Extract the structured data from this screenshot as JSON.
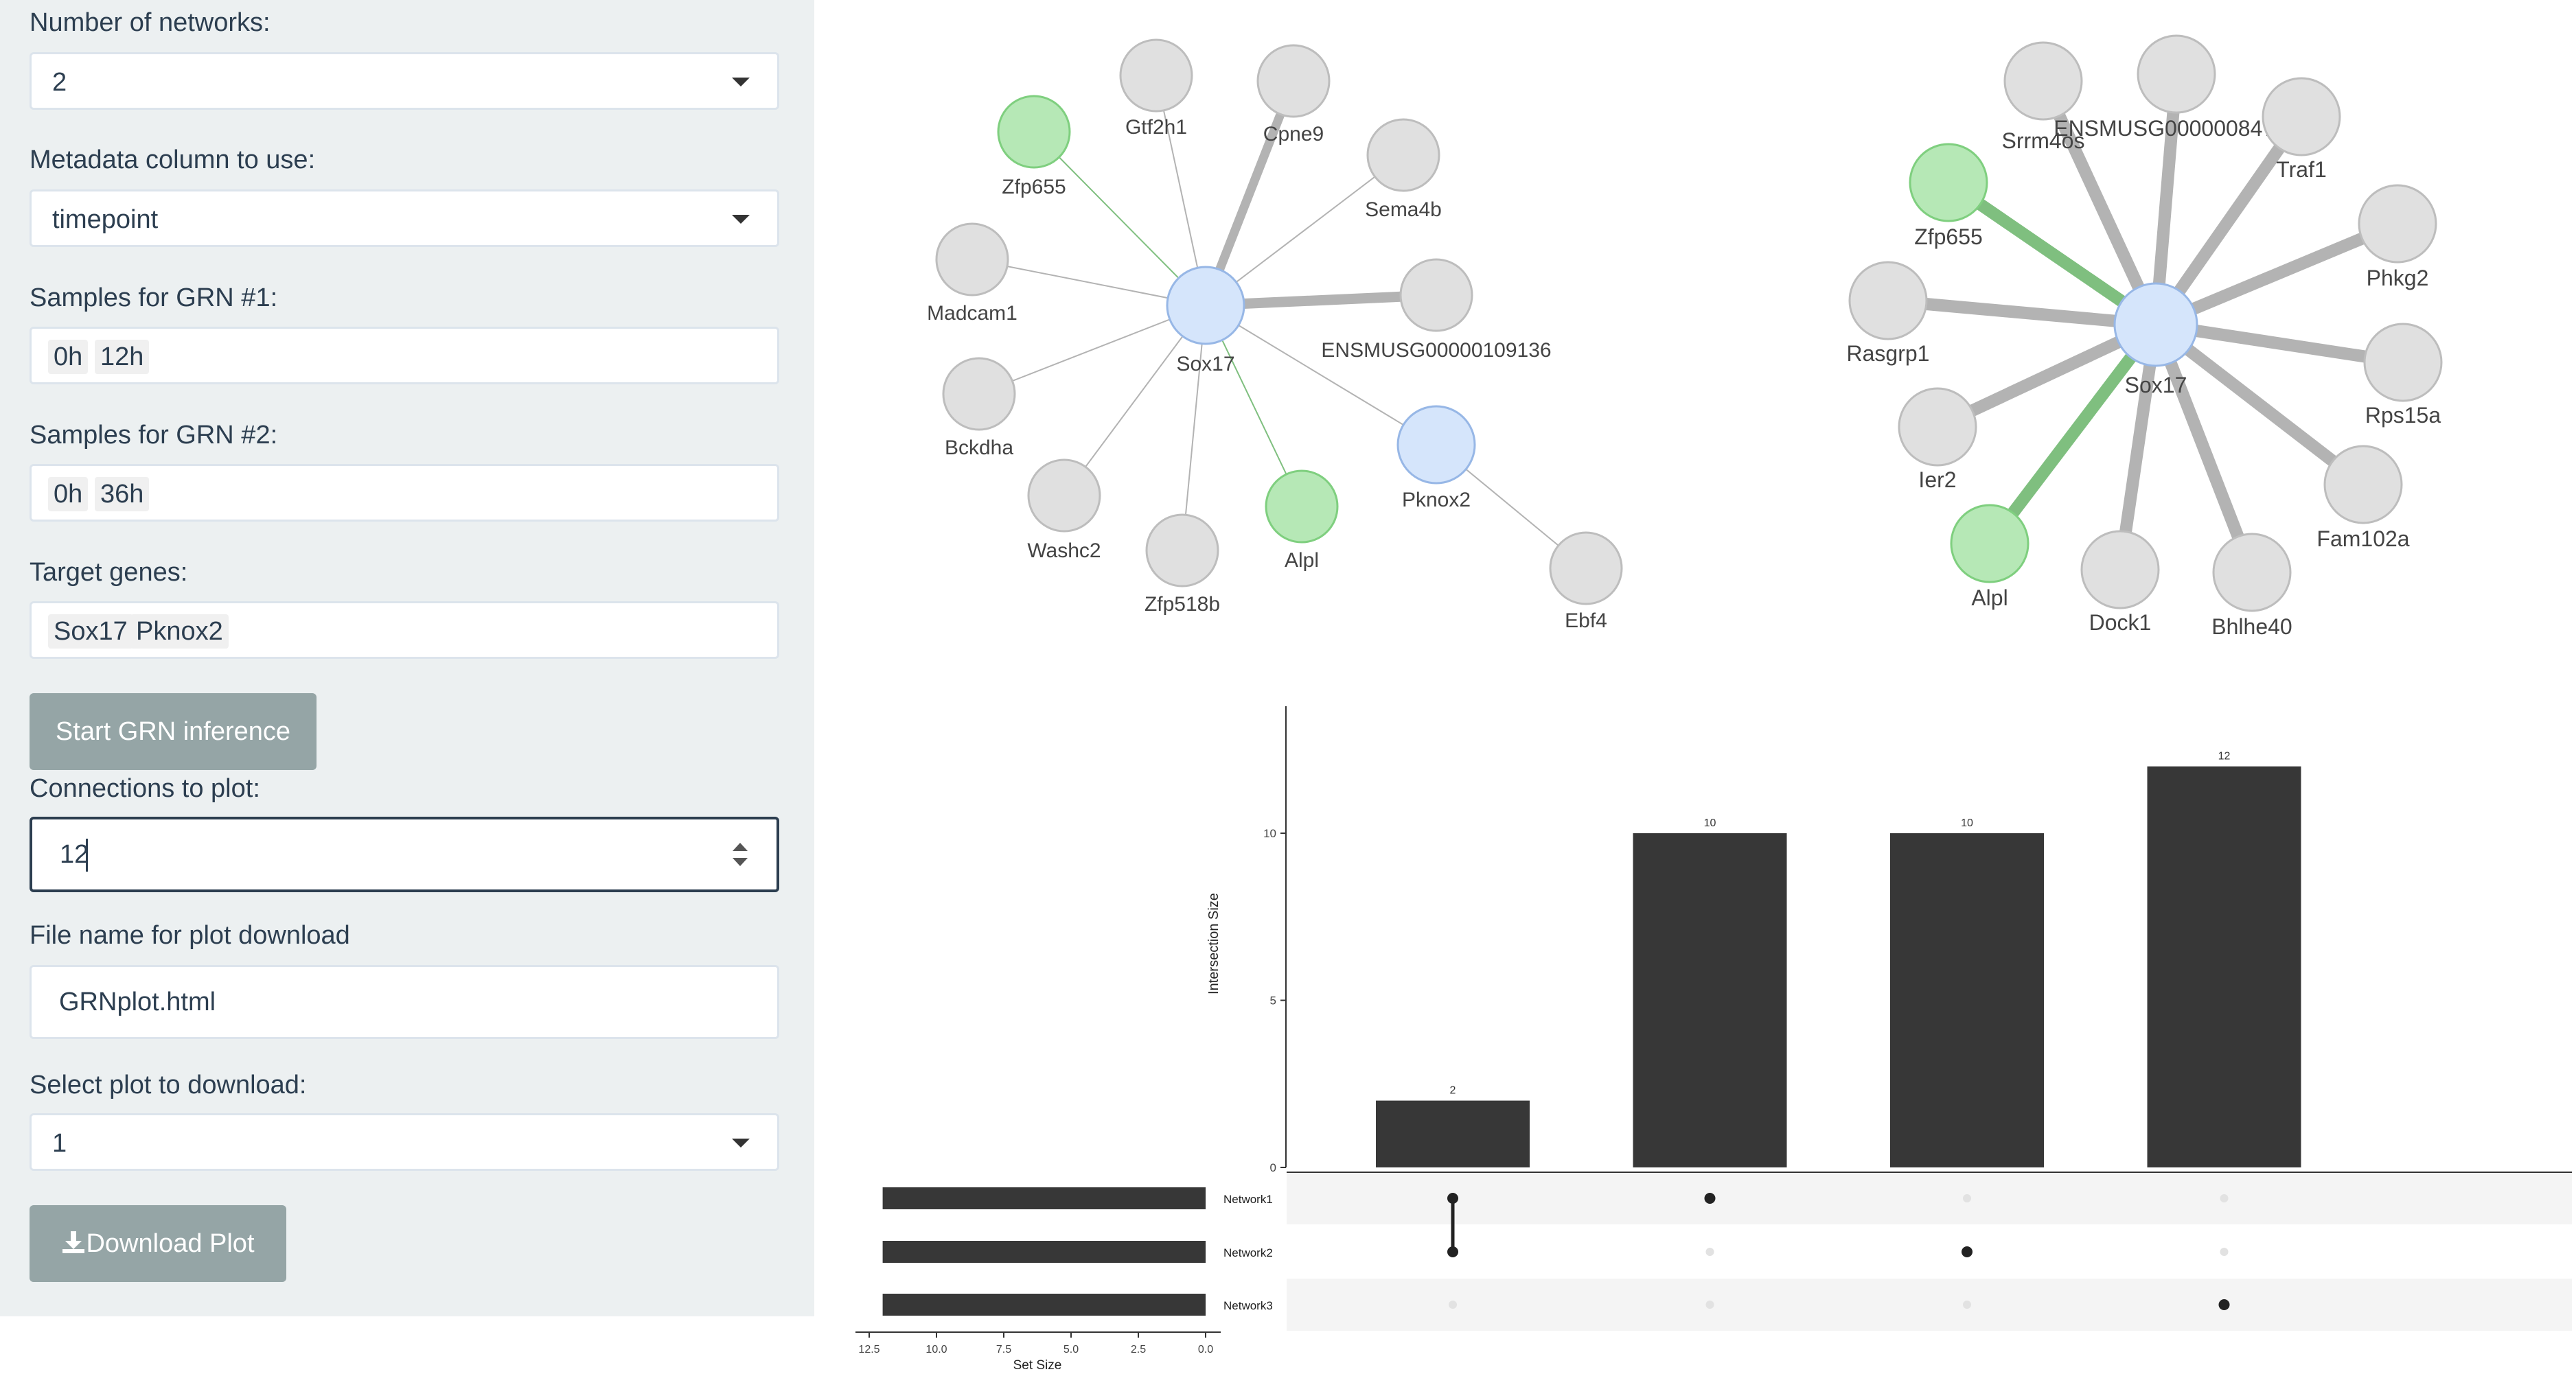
{
  "sidebar": {
    "num_networks_label": "Number of networks:",
    "num_networks_value": "2",
    "metadata_label": "Metadata column to use:",
    "metadata_value": "timepoint",
    "samples1_label": "Samples for GRN #1:",
    "samples1_chips": [
      "0h",
      "12h"
    ],
    "samples2_label": "Samples for GRN #2:",
    "samples2_chips": [
      "0h",
      "36h"
    ],
    "targets_label": "Target genes:",
    "targets_chips": [
      "Sox17",
      "Pknox2"
    ],
    "start_button": "Start GRN inference",
    "connections_label": "Connections to plot:",
    "connections_value": "12",
    "filename_label": "File name for plot download",
    "filename_value": "GRNplot.html",
    "select_plot_label": "Select plot to download:",
    "select_plot_value": "1",
    "download_button": "Download Plot",
    "icons": {
      "caret": "chevron-down-icon",
      "download": "download-icon",
      "spinner": "number-spinner-icon"
    }
  },
  "network1": {
    "nodes": [
      "Sox17",
      "Gtf2h1",
      "Cpne9",
      "Zfp655",
      "Sema4b",
      "Madcam1",
      "ENSMUSG00000109136",
      "Bckdha",
      "Pknox2",
      "Washc2",
      "Zfp518b",
      "Alpl",
      "Ebf4"
    ],
    "edges": [
      [
        "Sox17",
        "Gtf2h1"
      ],
      [
        "Sox17",
        "Cpne9"
      ],
      [
        "Sox17",
        "Zfp655"
      ],
      [
        "Sox17",
        "Sema4b"
      ],
      [
        "Sox17",
        "Madcam1"
      ],
      [
        "Sox17",
        "ENSMUSG00000109136"
      ],
      [
        "Sox17",
        "Bckdha"
      ],
      [
        "Sox17",
        "Pknox2"
      ],
      [
        "Sox17",
        "Washc2"
      ],
      [
        "Sox17",
        "Zfp518b"
      ],
      [
        "Sox17",
        "Alpl"
      ],
      [
        "Pknox2",
        "Ebf4"
      ]
    ]
  },
  "network2": {
    "nodes": [
      "Sox17",
      "Srrm4os",
      "ENSMUSG00000084758",
      "Traf1",
      "Zfp655",
      "Phkg2",
      "Rasgrp1",
      "Rps15a",
      "Ier2",
      "Fam102a",
      "Alpl",
      "Dock1",
      "Bhlhe40"
    ],
    "edges": [
      [
        "Sox17",
        "Srrm4os"
      ],
      [
        "Sox17",
        "ENSMUSG00000084758"
      ],
      [
        "Sox17",
        "Traf1"
      ],
      [
        "Sox17",
        "Zfp655"
      ],
      [
        "Sox17",
        "Phkg2"
      ],
      [
        "Sox17",
        "Rasgrp1"
      ],
      [
        "Sox17",
        "Rps15a"
      ],
      [
        "Sox17",
        "Ier2"
      ],
      [
        "Sox17",
        "Fam102a"
      ],
      [
        "Sox17",
        "Alpl"
      ],
      [
        "Sox17",
        "Dock1"
      ],
      [
        "Sox17",
        "Bhlhe40"
      ]
    ]
  },
  "colors": {
    "sidebar_bg": "#ecf0f1",
    "button": "#95a5a6",
    "node_default": "#e0e0e0",
    "node_target": "#d5e5fb",
    "node_green": "#b6e8b6",
    "edge_gray": "#b3b3b3",
    "edge_green": "#7fbf7f",
    "bar": "#373737"
  },
  "chart_data": {
    "type": "bar",
    "subtype": "upset",
    "ylabel": "Intersection Size",
    "xlabel_sets": "Set Size",
    "intersection_sizes": [
      2,
      10,
      10,
      12
    ],
    "intersection_labels": [
      "2",
      "10",
      "10",
      "12"
    ],
    "sets": [
      "Network1",
      "Network2",
      "Network3"
    ],
    "set_sizes": [
      12,
      12,
      12
    ],
    "membership": [
      [
        1,
        1,
        0
      ],
      [
        1,
        0,
        0
      ],
      [
        0,
        1,
        0
      ],
      [
        0,
        0,
        1
      ]
    ],
    "y_ticks": [
      "0",
      "5",
      "10"
    ],
    "x_ticks_sets": [
      "12.5",
      "10.0",
      "7.5",
      "5.0",
      "2.5",
      "0.0"
    ],
    "ylim": [
      0,
      13.8
    ]
  }
}
